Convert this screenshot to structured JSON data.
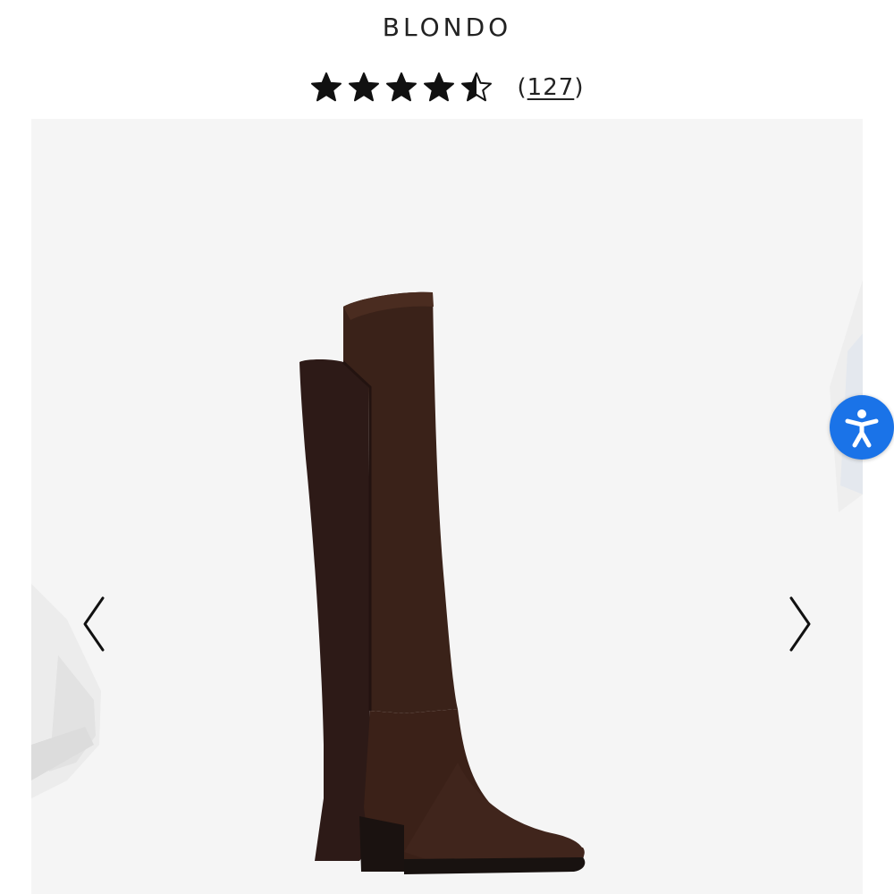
{
  "product": {
    "brand": "BLONDO",
    "rating": 4.5,
    "rating_max": 5,
    "review_count_label": "127",
    "review_open": "(",
    "review_close": ")"
  },
  "gallery": {
    "main_image_icon": "knee-high-boot-image",
    "prev_arrow_icon": "chevron-left-icon",
    "next_arrow_icon": "chevron-right-icon"
  },
  "accessibility": {
    "icon": "accessibility-icon",
    "color": "#1a73e8"
  },
  "colors": {
    "boot_suede": "#3b2118",
    "boot_stretch": "#2e1a16",
    "background": "#f5f5f5"
  }
}
